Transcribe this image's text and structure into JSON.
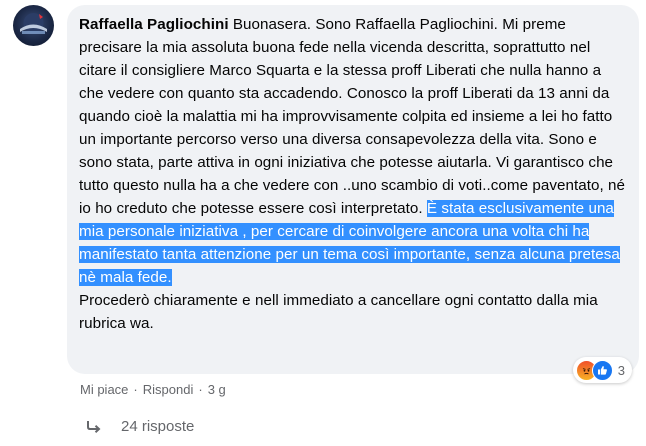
{
  "comment": {
    "author": "Raffaella Pagliochini",
    "text_before": "Buonasera. Sono Raffaella Pagliochini. Mi preme precisare la mia assoluta buona fede nella vicenda descritta, soprattutto nel citare il consigliere Marco Squarta e la stessa proff Liberati che nulla hanno a che vedere con quanto sta accadendo. Conosco la proff Liberati da 13 anni da quando cioè la malattia mi ha improvvisamente colpita ed insieme a lei ho fatto un importante percorso verso una diversa consapevolezza della vita. Sono e sono stata, parte attiva in ogni iniziativa che potesse aiutarla. Vi garantisco che tutto questo nulla ha a che vedere con ..uno scambio di voti..come paventato, né io ho creduto che potesse essere così interpretato. ",
    "text_highlighted": "È stata esclusivamente una mia personale iniziativa , per cercare di coinvolgere ancora una volta chi ha manifestato tanta attenzione per un tema così importante, senza alcuna pretesa nè mala fede.",
    "text_after": "Procederò chiaramente e nell immediato a cancellare ogni contatto dalla mia rubrica wa."
  },
  "reactions": {
    "icons": [
      "angry-icon",
      "like-icon"
    ],
    "count": "3"
  },
  "actions": {
    "like": "Mi piace",
    "reply": "Rispondi",
    "separator": "·",
    "time": "3 g"
  },
  "replies": {
    "label": "24 risposte"
  },
  "colors": {
    "bubble": "#f0f2f5",
    "highlight": "#3390ff",
    "meta": "#65676b",
    "like": "#1877f2"
  }
}
